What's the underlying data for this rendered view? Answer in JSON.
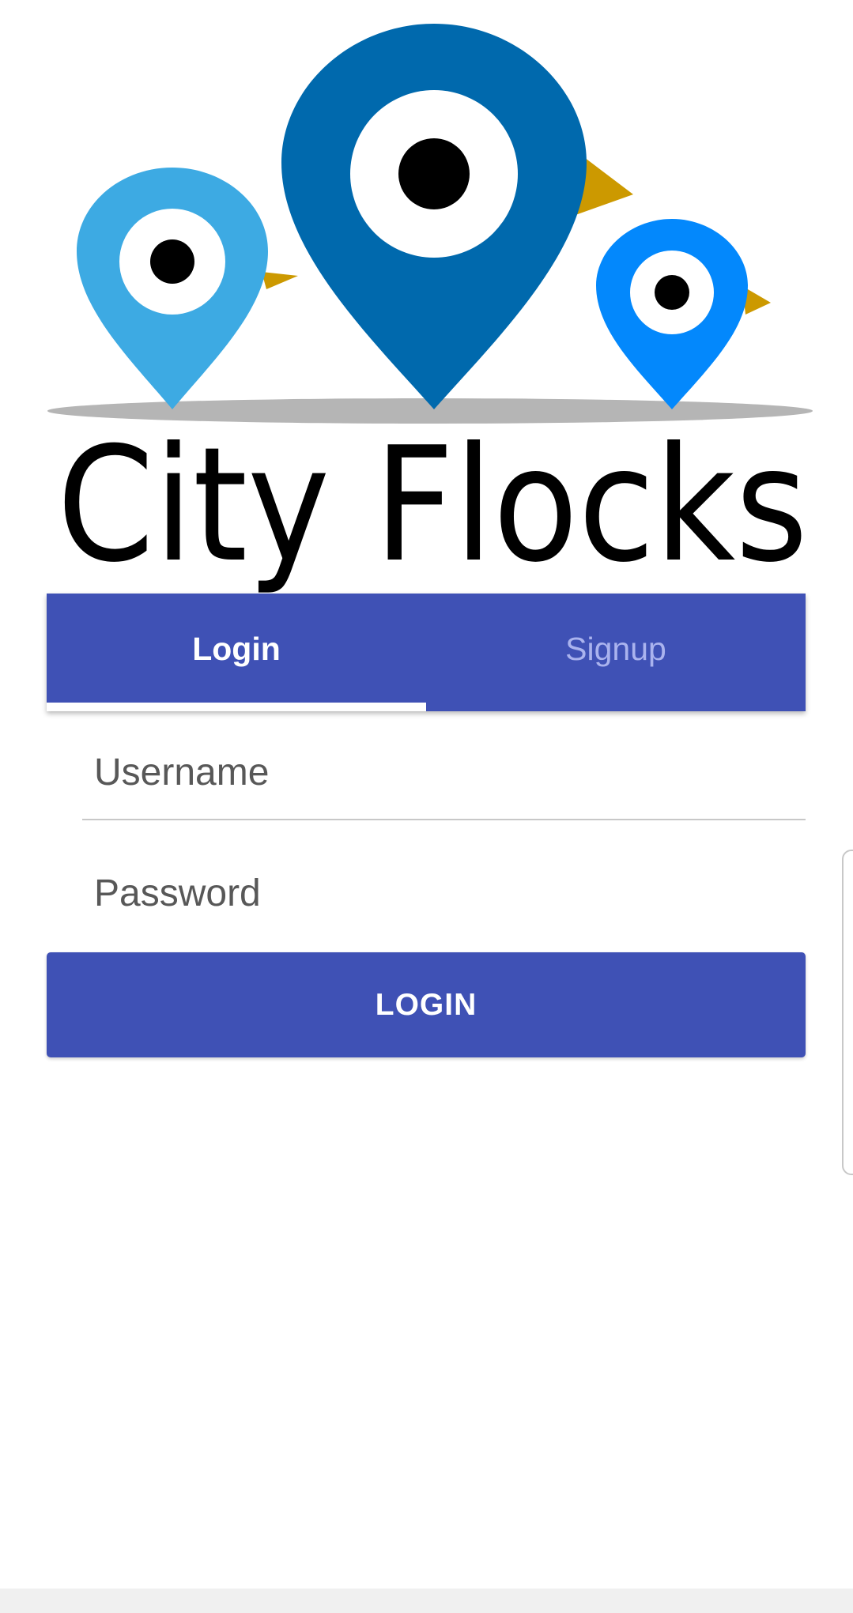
{
  "app": {
    "name": "City Flocks"
  },
  "tabs": [
    {
      "label": "Login",
      "active": true
    },
    {
      "label": "Signup",
      "active": false
    }
  ],
  "form": {
    "username_placeholder": "Username",
    "password_placeholder": "Password",
    "username_value": "",
    "password_value": ""
  },
  "actions": {
    "login_label": "LOGIN"
  },
  "colors": {
    "primary": "#3f51b5",
    "tab_inactive_text": "#aab3ee",
    "bird_large": "#0069ad",
    "bird_left": "#3daae3",
    "bird_right": "#0388fc",
    "beak": "#cc9900",
    "shadow": "#b5b5b5"
  },
  "icons": [
    "bird-pin-icon-left",
    "bird-pin-icon-center",
    "bird-pin-icon-right"
  ]
}
